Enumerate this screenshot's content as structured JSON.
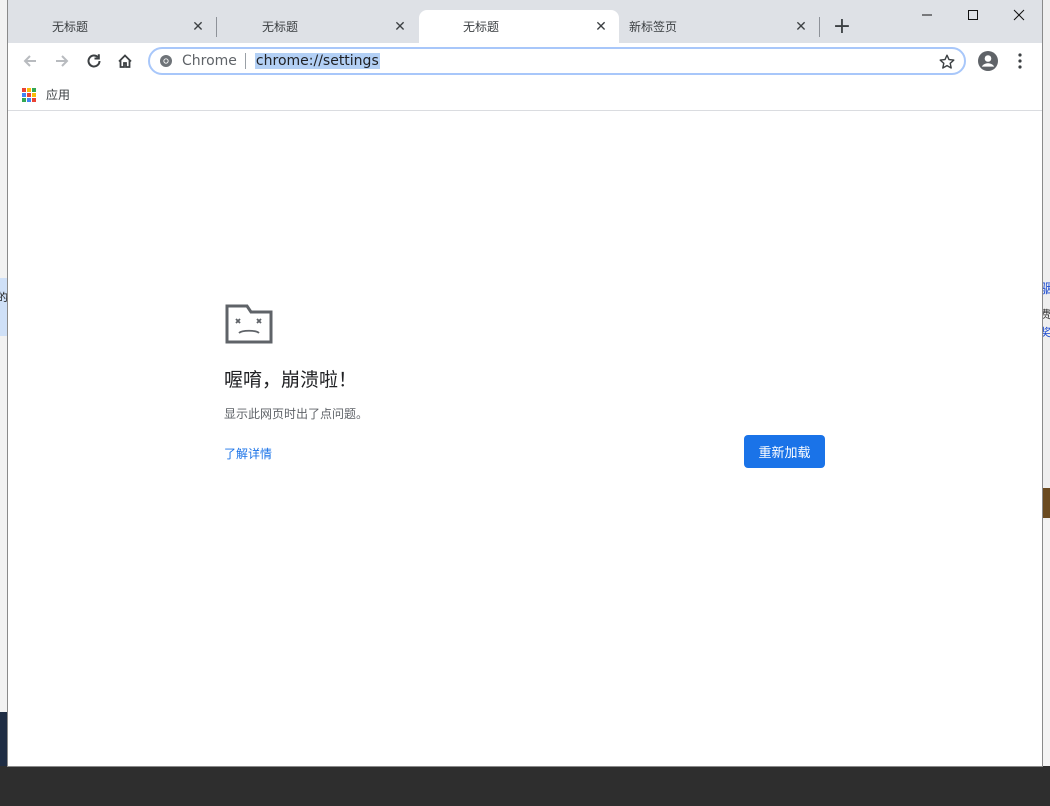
{
  "window": {
    "tabs": [
      {
        "label": "无标题"
      },
      {
        "label": "无标题"
      },
      {
        "label": "无标题"
      },
      {
        "label": "新标签页"
      }
    ],
    "new_tab_icon": "+",
    "controls": {
      "minimize": "—",
      "maximize": "☐",
      "close": "✕"
    }
  },
  "toolbar": {
    "chip": "Chrome",
    "url": "chrome://settings"
  },
  "bookmarks": {
    "apps_label": "应用",
    "apps_colors": [
      "#ea4335",
      "#fbbc04",
      "#34a853",
      "#4285f4",
      "#ea4335",
      "#fbbc04",
      "#34a853",
      "#4285f4",
      "#ea4335"
    ]
  },
  "crash": {
    "title": "喔唷，崩溃啦！",
    "message": "显示此网页时出了点问题。",
    "learn_more": "了解详情",
    "reload": "重新加载"
  },
  "desktop": {
    "left_char": "的",
    "right_chars": [
      "骃",
      "费",
      "奖"
    ]
  },
  "colors": {
    "accent": "#1a73e8",
    "tabstrip": "#dee1e6",
    "selection": "#b3d0f5"
  }
}
